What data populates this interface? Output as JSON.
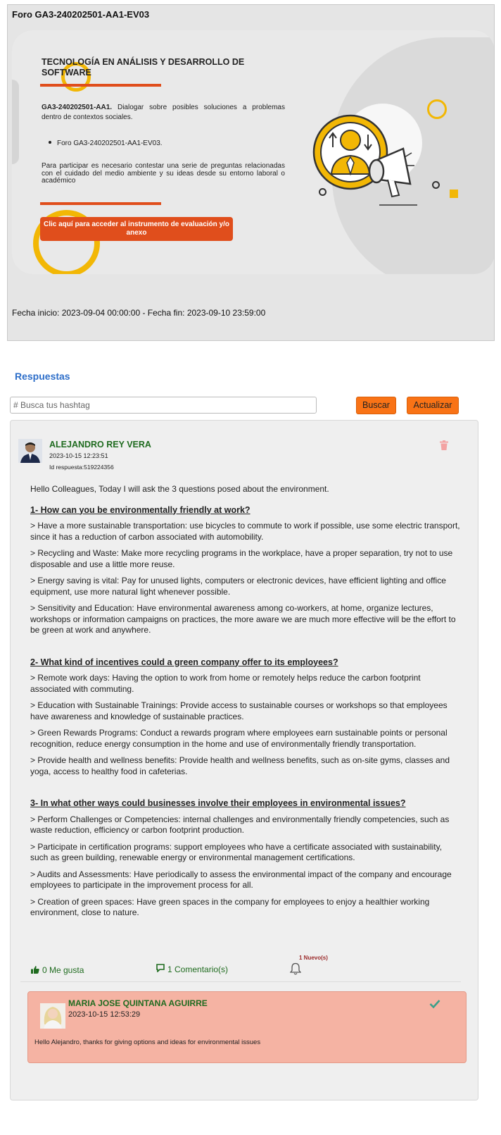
{
  "forum": {
    "title": "Foro GA3-240202501-AA1-EV03",
    "banner": {
      "heading": "TECNOLOGÍA EN ANÁLISIS Y DESARROLLO DE SOFTWARE",
      "activity_code": "GA3-240202501-AA1.",
      "activity_desc": " Dialogar sobre posibles soluciones a problemas dentro de contextos sociales.",
      "list_item": "Foro GA3-240202501-AA1-EV03.",
      "participation": "Para participar es necesario contestar una serie de preguntas relacionadas con el cuidado del medio ambiente y su ideas desde su entorno laboral o académico",
      "cta_label": "Clic aquí para acceder al instrumento de evaluación y/o anexo"
    },
    "dates": "Fecha inicio: 2023-09-04 00:00:00 - Fecha fin: 2023-09-10 23:59:00"
  },
  "responses": {
    "title": "Respuestas",
    "search_placeholder": "# Busca tus hashtag",
    "search_button": "Buscar",
    "refresh_button": "Actualizar"
  },
  "post": {
    "author": "ALEJANDRO REY VERA",
    "timestamp": "2023-10-15 12:23:51",
    "response_id": "Id respuesta:519224356",
    "intro": "Hello Colleagues, Today I will ask the 3 questions posed about the environment.",
    "sections": [
      {
        "heading": "1- How can you be environmentally friendly at work?",
        "items": [
          "> Have a more sustainable transportation: use bicycles to commute to work if possible, use some electric transport, since it has a reduction of carbon associated with automobility.",
          "> Recycling and Waste: Make more recycling programs in the workplace, have a proper separation, try not to use   disposable and use a little more reuse.",
          "> Energy saving is vital: Pay for unused lights, computers or electronic devices, have efficient lighting and office equipment, use more natural light whenever possible.",
          "> Sensitivity and Education: Have environmental awareness among co-workers, at home, organize lectures, workshops or information campaigns on practices, the more aware we are much more effective will be the effort to be green at work and anywhere."
        ]
      },
      {
        "heading": "2- What kind of incentives could a green company offer to its employees?",
        "items": [
          "> Remote work days: Having the option to work from home or remotely helps reduce the carbon footprint associated with commuting.",
          "> Education with Sustainable Trainings: Provide access to sustainable courses or workshops so that employees have awareness and knowledge of sustainable practices.",
          "> Green Rewards Programs: Conduct a rewards program where employees earn sustainable points or personal recognition, reduce energy consumption in the home and use of environmentally friendly transportation.",
          "> Provide health and wellness benefits: Provide health and wellness benefits, such as on-site gyms, classes and yoga, access to healthy food in cafeterias."
        ]
      },
      {
        "heading": "3- In what other ways could businesses involve their employees in environmental issues?",
        "items": [
          "> Perform Challenges or Competencies: internal challenges and environmentally friendly competencies, such as waste reduction, efficiency or carbon footprint production.",
          "> Participate in certification programs: support employees who have a certificate associated with sustainability, such as green building, renewable energy or environmental management certifications.",
          "> Audits and Assessments: Have periodically to assess the environmental impact of the company and encourage employees to participate in the improvement process for all.",
          "> Creation of green spaces: Have green spaces in the company for employees to enjoy a healthier working environment, close to nature."
        ]
      }
    ],
    "likes": "0 Me gusta",
    "comments": "1 Comentario(s)",
    "new_badge": "1 Nuevo(s)"
  },
  "comment": {
    "author": "MARIA JOSE QUINTANA AGUIRRE",
    "timestamp": "2023-10-15 12:53:29",
    "text": "Hello Alejandro, thanks for giving options and ideas for environmental issues"
  },
  "colors": {
    "accent_orange": "#f97316",
    "banner_orange": "#e04e1c",
    "name_green": "#1f6b1f",
    "link_blue": "#2d6ec9",
    "comment_bg": "#f5b3a3"
  }
}
